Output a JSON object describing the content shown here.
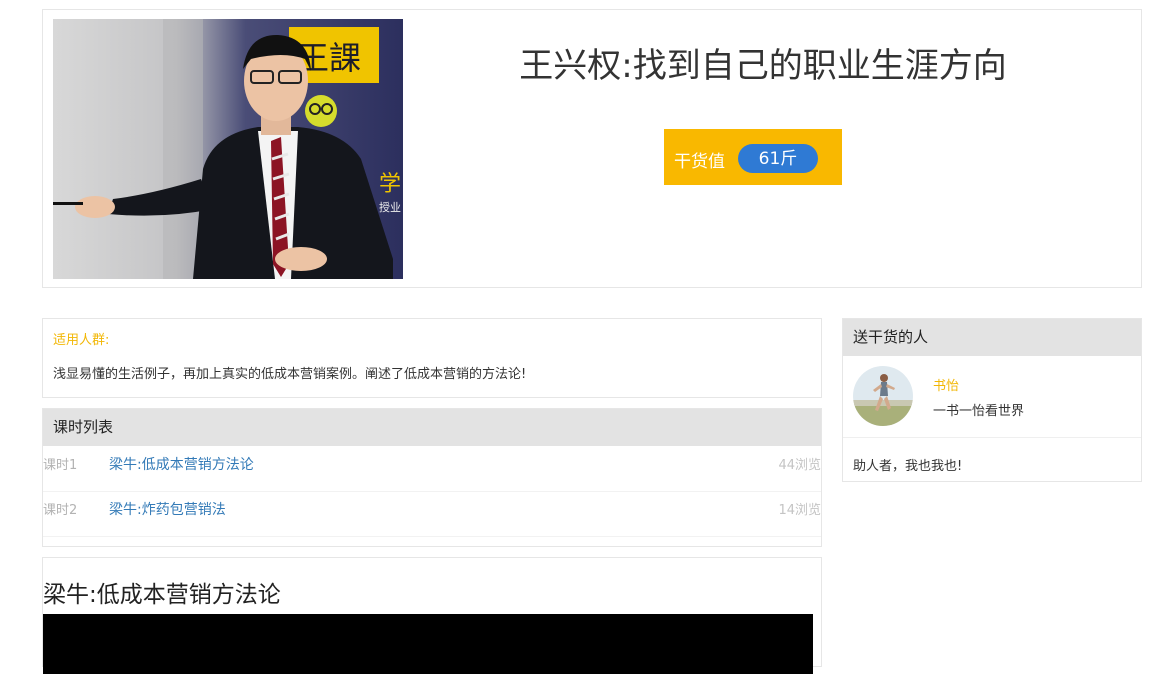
{
  "course": {
    "title": "王兴权:找到自己的职业生涯方向",
    "value_label": "干货值",
    "value_amount": "61斤",
    "photo_sign_text": "王課",
    "photo_sign_text2": "学",
    "photo_sign_text3": "授业"
  },
  "audience": {
    "label": "适用人群:",
    "text": "浅显易懂的生活例子，再加上真实的低成本营销案例。阐述了低成本营销的方法论!"
  },
  "lessons": {
    "header": "课时列表",
    "items": [
      {
        "num": "课时1",
        "title": "梁牛:低成本营销方法论",
        "views": "44浏览"
      },
      {
        "num": "课时2",
        "title": "梁牛:炸药包营销法",
        "views": "14浏览"
      }
    ]
  },
  "video": {
    "title": "梁牛:低成本营销方法论"
  },
  "givers": {
    "header": "送干货的人",
    "items": [
      {
        "name": "书怡",
        "motto": "一书一怡看世界"
      }
    ],
    "note": "助人者，我也我也!"
  },
  "colors": {
    "accent_yellow": "#f9b800",
    "pill_blue": "#2f7ad4",
    "link_blue": "#337ab7"
  }
}
